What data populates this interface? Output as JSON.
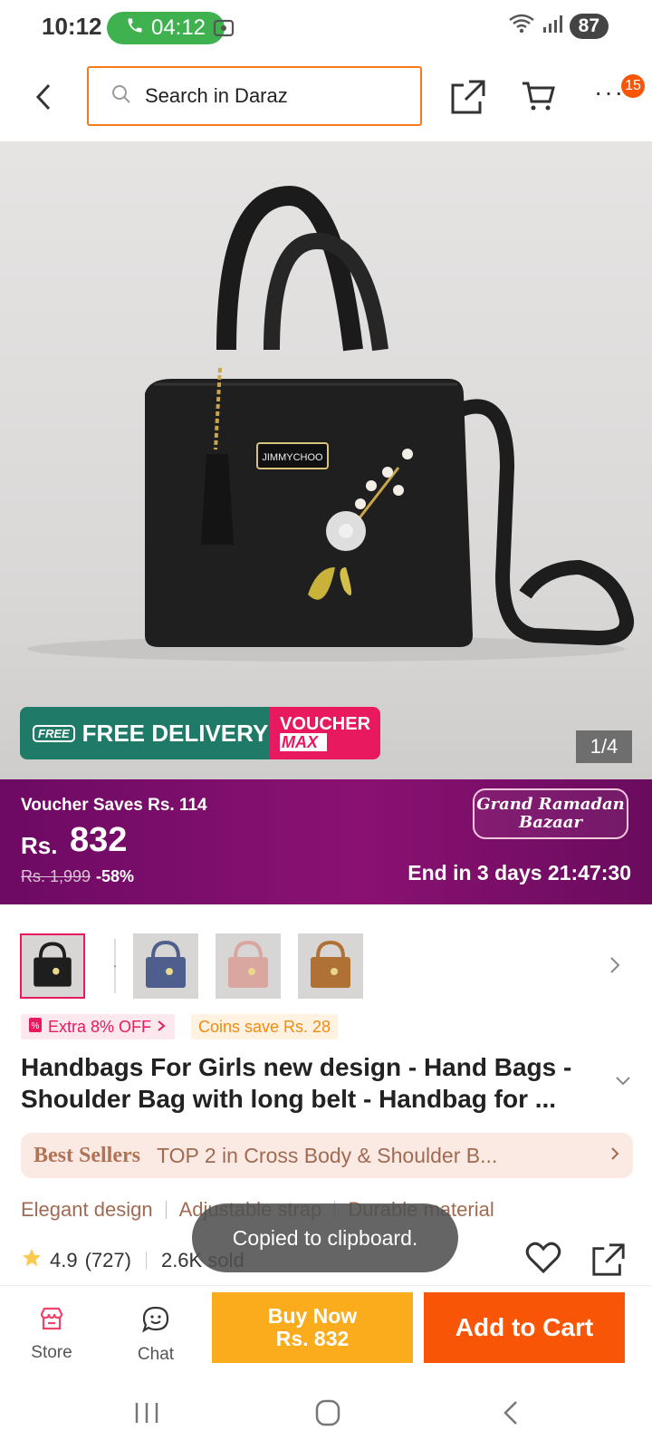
{
  "status_bar": {
    "time": "10:12",
    "call_timer": "04:12",
    "battery": "87"
  },
  "header": {
    "search_placeholder": "Search in Daraz",
    "cart_badge": "15"
  },
  "hero": {
    "image_counter": "1/4",
    "banner_free_tag": "FREE",
    "banner_free_text": "FREE DELIVERY",
    "banner_voucher_line1": "VOUCHER",
    "banner_voucher_line2": "MAX",
    "bag_logo": "JIMMYCHOO"
  },
  "price_band": {
    "voucher_saves": "Voucher Saves Rs. 114",
    "currency": "Rs.",
    "price": "832",
    "original_price": "Rs. 1,999",
    "discount": "-58%",
    "campaign_line1": "Grand Ramadan",
    "campaign_line2": "Bazaar",
    "ends_in": "End in 3 days 21:47:30"
  },
  "thumbnails": [
    {
      "color": "#1e1e1e"
    },
    {
      "color": "#1e1e1e"
    },
    {
      "color": "#4e5f8e"
    },
    {
      "color": "#d9a79f"
    },
    {
      "color": "#b07234"
    }
  ],
  "tags": {
    "extra_off": "Extra 8% OFF",
    "coins": "Coins save Rs. 28"
  },
  "product_title": "Handbags For Girls new design - Hand Bags - Shoulder Bag with long belt - Handbag for ...",
  "best_sellers": {
    "title": "Best Sellers",
    "text": "TOP 2 in Cross Body & Shoulder B..."
  },
  "features": [
    "Elegant design",
    "Adjustable strap",
    "Durable material"
  ],
  "rating": {
    "score": "4.9",
    "count": "(727)",
    "sold": "2.6K sold"
  },
  "toast": "Copied to clipboard.",
  "bottom_bar": {
    "store_label": "Store",
    "chat_label": "Chat",
    "buy_now_line1": "Buy Now",
    "buy_now_line2": "Rs. 832",
    "add_to_cart": "Add to Cart"
  },
  "colors": {
    "accent": "#f85606",
    "buy_now": "#fbac1c",
    "price_band": "#7a0d6a",
    "search_border": "#f37b1d"
  }
}
